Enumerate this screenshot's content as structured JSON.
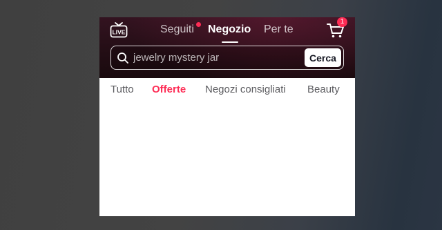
{
  "header": {
    "live_icon": "live-tv-icon",
    "live_label": "LIVE",
    "tabs": [
      {
        "label": "Seguiti",
        "active": false,
        "has_notification_dot": true
      },
      {
        "label": "Negozio",
        "active": true
      },
      {
        "label": "Per te",
        "active": false
      }
    ],
    "cart_icon": "shopping-cart-icon",
    "cart_badge": "1"
  },
  "search": {
    "value": "jewelry mystery jar",
    "icon": "search-icon",
    "button_label": "Cerca"
  },
  "categories": [
    {
      "label": "Tutto",
      "active": false
    },
    {
      "label": "Offerte",
      "active": true
    },
    {
      "label": "Negozi consigliati",
      "active": false
    },
    {
      "label": "Beauty",
      "active": false
    }
  ],
  "colors": {
    "accent": "#fe2c55",
    "header_bg": "#2a0f17"
  }
}
